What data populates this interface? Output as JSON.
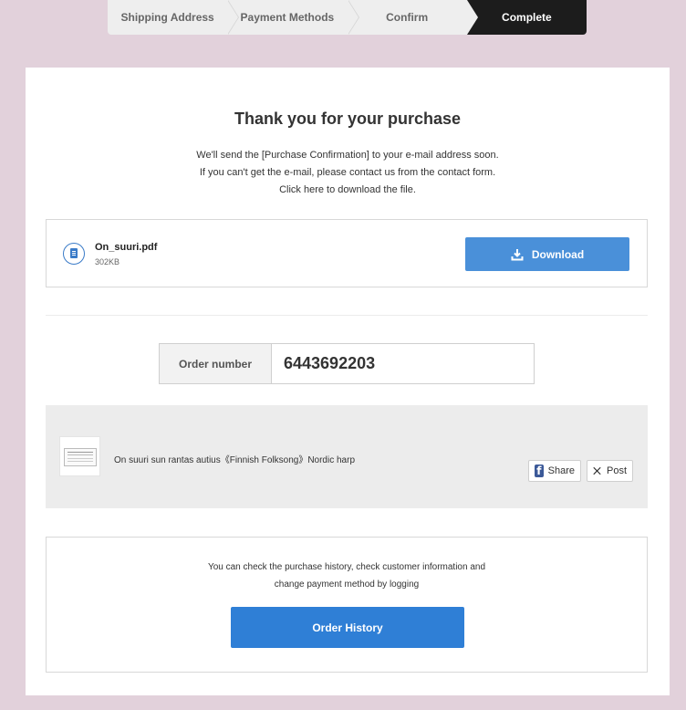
{
  "steps": [
    {
      "label": "Shipping Address"
    },
    {
      "label": "Payment Methods"
    },
    {
      "label": "Confirm"
    },
    {
      "label": "Complete"
    }
  ],
  "title": "Thank you for your purchase",
  "messages": [
    "We'll send the [Purchase Confirmation] to your e-mail address soon.",
    "If you can't get the e-mail, please contact us from the contact form.",
    "Click here to download the file."
  ],
  "file": {
    "name": "On_suuri.pdf",
    "size": "302KB",
    "download_label": "Download"
  },
  "order": {
    "label": "Order number",
    "number": "6443692203"
  },
  "product": {
    "name": "On suuri sun rantas autius《Finnish Folksong》Nordic harp",
    "share_label": "Share",
    "post_label": "Post"
  },
  "history": {
    "line1": "You can check the purchase history, check customer information and",
    "line2": "change payment method by logging",
    "button_label": "Order History"
  },
  "colors": {
    "background": "#e2d1db",
    "active_step": "#1c1c1c",
    "download_button": "#4a90d9",
    "history_button": "#2f7fd6",
    "facebook": "#3b5998"
  },
  "icons": {
    "file": "file-pdf-icon",
    "download": "download-icon",
    "facebook": "facebook-icon",
    "x": "x-icon"
  }
}
